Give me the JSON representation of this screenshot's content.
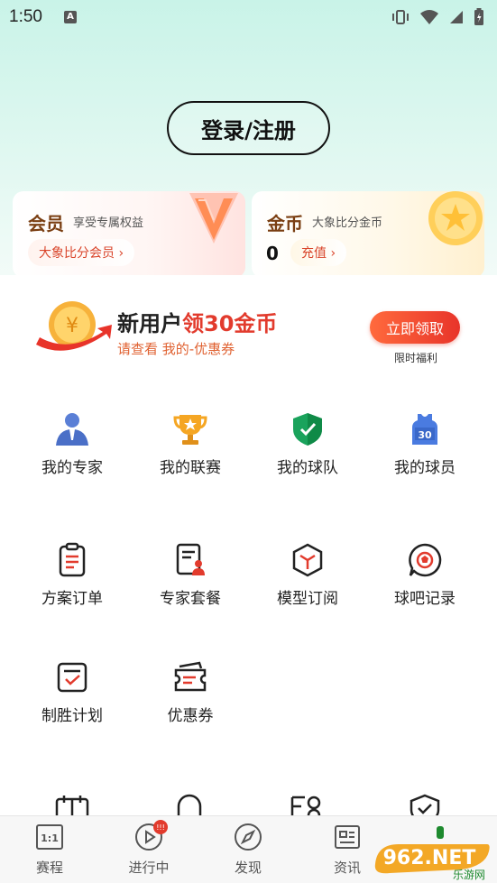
{
  "status_bar": {
    "time": "1:50",
    "a_icon": "A"
  },
  "login": {
    "label": "登录/注册"
  },
  "vip_card": {
    "title": "会员",
    "subtitle": "享受专属权益",
    "action": "大象比分会员 ›"
  },
  "coin_card": {
    "title": "金币",
    "subtitle": "大象比分金币",
    "count": "0",
    "action": "充值 ›"
  },
  "promo": {
    "title_prefix": "新用户",
    "title_highlight": "领30金币",
    "subtitle": "请查看 我的-优惠券",
    "button": "立即领取",
    "note": "限时福利"
  },
  "grid": {
    "expert": "我的专家",
    "league": "我的联赛",
    "team": "我的球队",
    "player": "我的球员",
    "orders": "方案订单",
    "packages": "专家套餐",
    "model": "模型订阅",
    "forum": "球吧记录",
    "plan": "制胜计划",
    "coupon": "优惠券"
  },
  "tabs": {
    "schedule": "赛程",
    "schedule_icon_text": "1:1",
    "live": "进行中",
    "discover": "发现",
    "news": "资讯",
    "live_badge": "!!!"
  },
  "watermark": {
    "text": "962.NET",
    "sub": "乐游网"
  },
  "colors": {
    "accent_red": "#e23b2d",
    "brand_brown": "#7a3e12",
    "top_gradient": "#c9f3e8"
  }
}
